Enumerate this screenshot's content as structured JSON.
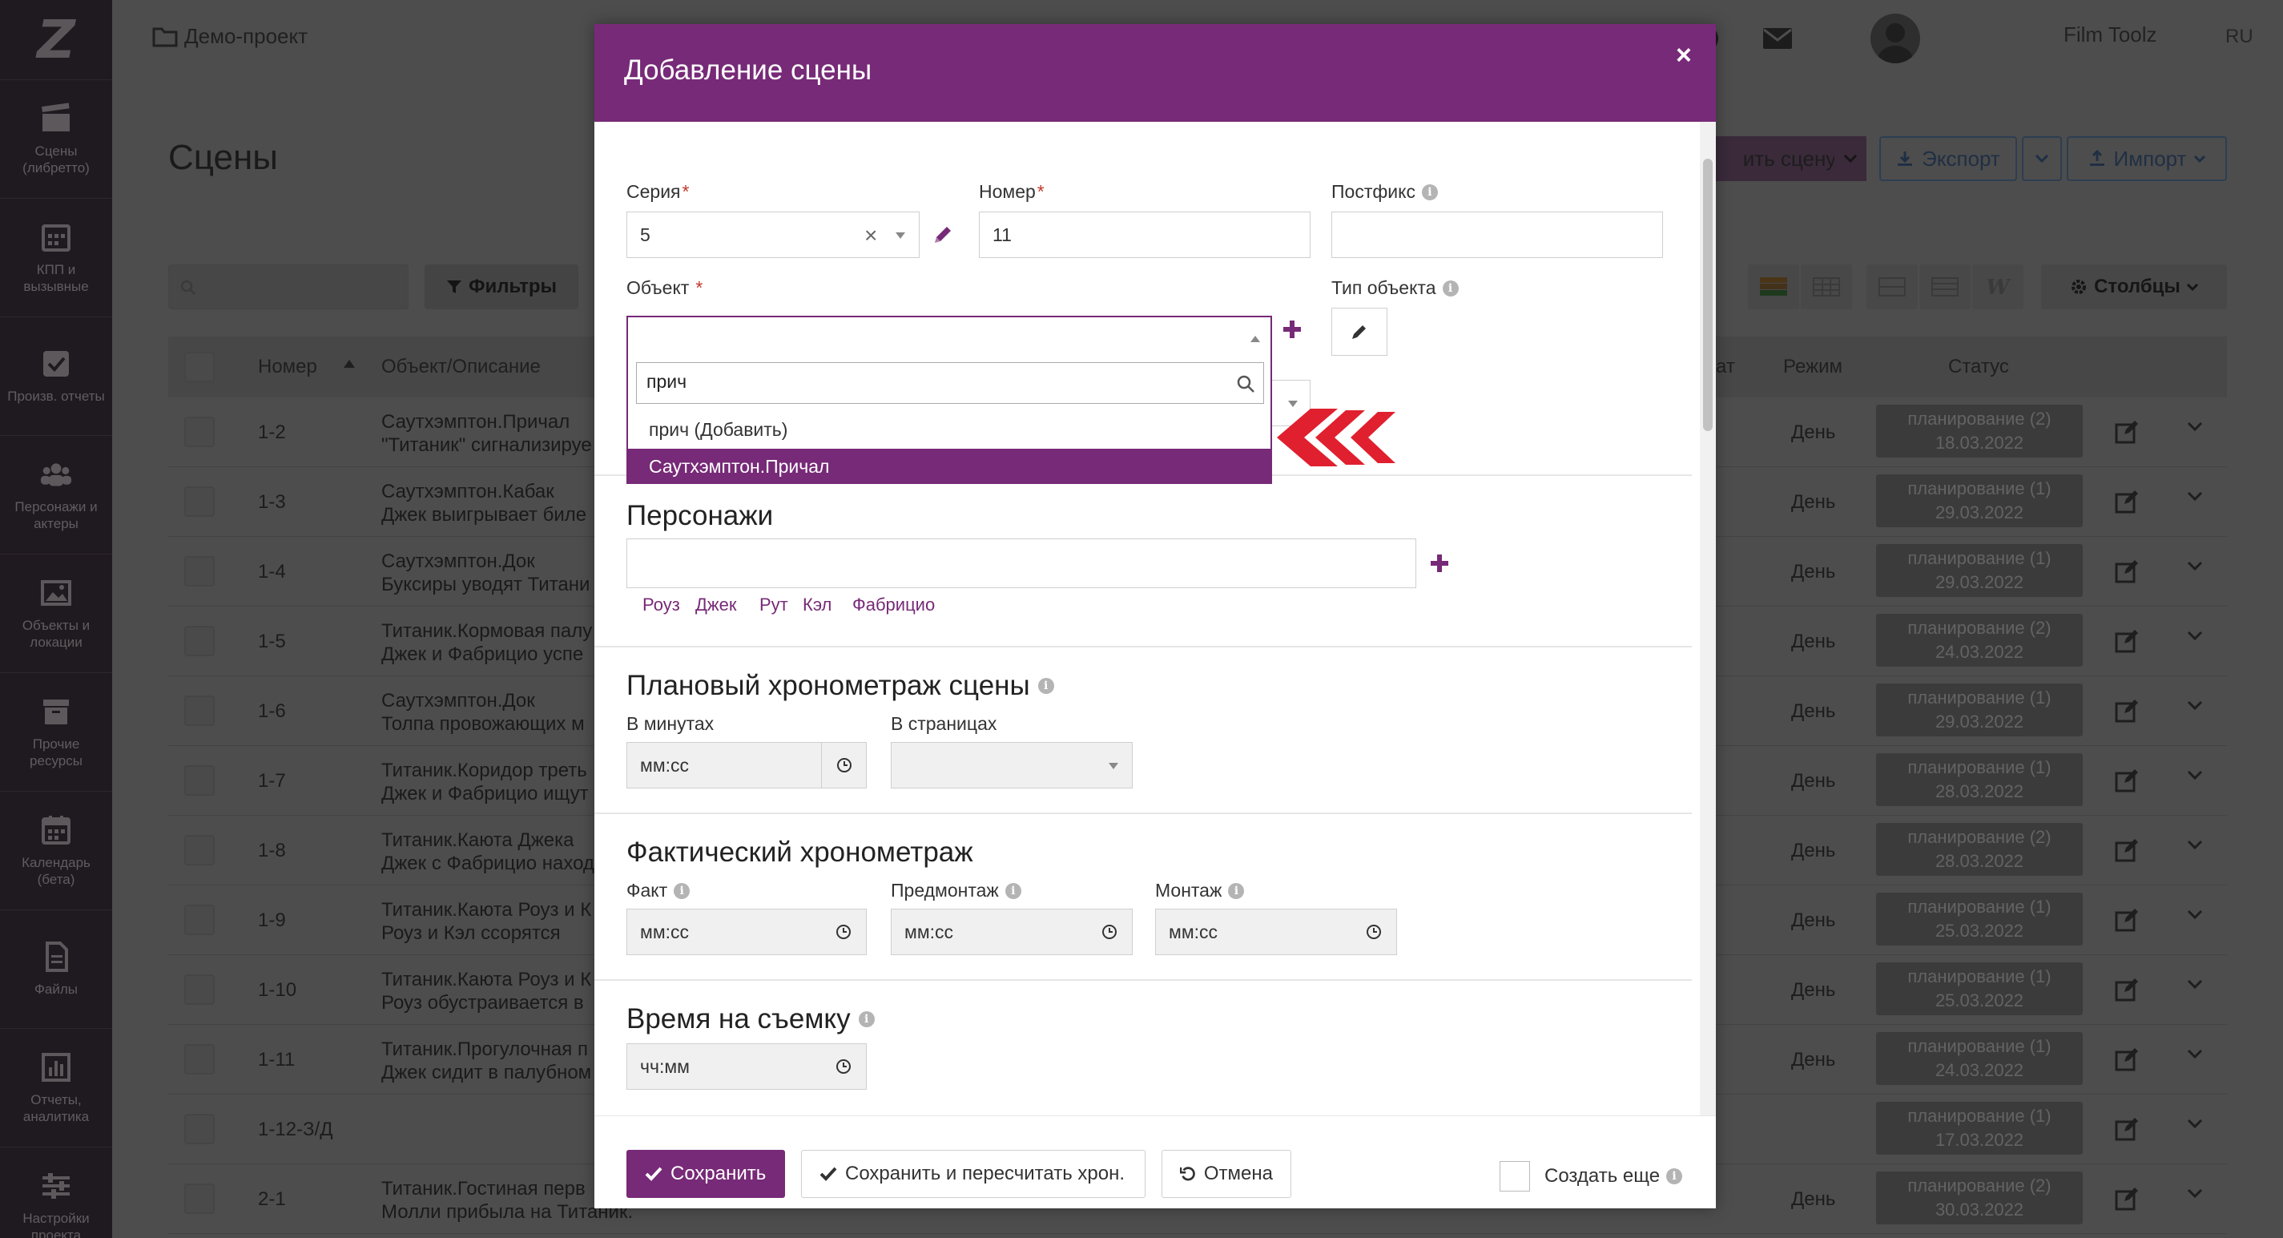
{
  "sidebar": {
    "logo": "Z",
    "items": [
      {
        "label": "Сцены\n(либретто)",
        "icon": "clapperboard-icon"
      },
      {
        "label": "КПП и\nвызывные",
        "icon": "calendar-grid-icon"
      },
      {
        "label": "Произв. отчеты",
        "icon": "checkbox-icon"
      },
      {
        "label": "Персонажи и\nактеры",
        "icon": "people-icon"
      },
      {
        "label": "Объекты и\nлокации",
        "icon": "image-icon"
      },
      {
        "label": "Прочие\nресурсы",
        "icon": "archive-icon"
      },
      {
        "label": "Календарь\n(бета)",
        "icon": "calendar-icon"
      },
      {
        "label": "Файлы",
        "icon": "file-icon"
      },
      {
        "label": "Отчеты,\nаналитика",
        "icon": "bar-chart-icon"
      },
      {
        "label": "Настройки\nпроекта",
        "icon": "sliders-icon"
      }
    ]
  },
  "header": {
    "breadcrumb": "Демо-проект",
    "username": "Film Toolz",
    "lang": "RU"
  },
  "page": {
    "title": "Сцены",
    "add_scene_partial": "ить сцену",
    "export_label": "Экспорт",
    "import_label": "Импорт",
    "filters_label": "Фильтры",
    "columns_label": "Столбцы",
    "table_headers": {
      "number": "Номер",
      "object": "Объект/Описание",
      "date_partial": "ат",
      "mode": "Режим",
      "status": "Статус"
    },
    "rows": [
      {
        "num": "1-2",
        "line1": "Саутхэмптон.Причал",
        "line2": "\"Титаник\" сигнализируе",
        "mode": "День",
        "status1": "планирование (2)",
        "status2": "18.03.2022"
      },
      {
        "num": "1-3",
        "line1": "Саутхэмптон.Кабак",
        "line2": "Джек выигрывает биле",
        "mode": "День",
        "status1": "планирование (1)",
        "status2": "29.03.2022"
      },
      {
        "num": "1-4",
        "line1": "Саутхэмптон.Док",
        "line2": "Буксиры уводят Титани",
        "mode": "День",
        "status1": "планирование (1)",
        "status2": "29.03.2022"
      },
      {
        "num": "1-5",
        "line1": "Титаник.Кормовая палу",
        "line2": "Джек и Фабрицио успе",
        "mode": "День",
        "status1": "планирование (2)",
        "status2": "24.03.2022"
      },
      {
        "num": "1-6",
        "line1": "Саутхэмптон.Док",
        "line2": "Толпа провожающих м",
        "mode": "День",
        "status1": "планирование (1)",
        "status2": "29.03.2022"
      },
      {
        "num": "1-7",
        "line1": "Титаник.Коридор треть",
        "line2": "Джек и Фабрицио ищут",
        "mode": "День",
        "status1": "планирование (1)",
        "status2": "28.03.2022"
      },
      {
        "num": "1-8",
        "line1": "Титаник.Каюта Джека",
        "line2": "Джек с Фабрицио наход",
        "mode": "День",
        "status1": "планирование (2)",
        "status2": "28.03.2022"
      },
      {
        "num": "1-9",
        "line1": "Титаник.Каюта Роуз и К",
        "line2": "Роуз и Кэл ссорятся",
        "mode": "День",
        "status1": "планирование (1)",
        "status2": "25.03.2022"
      },
      {
        "num": "1-10",
        "line1": "Титаник.Каюта Роуз и К",
        "line2": "Роуз обустраивается в",
        "mode": "День",
        "status1": "планирование (1)",
        "status2": "25.03.2022"
      },
      {
        "num": "1-11",
        "line1": "Титаник.Прогулочная п",
        "line2": "Джек сидит в палубном",
        "mode": "День",
        "status1": "планирование (1)",
        "status2": "24.03.2022"
      },
      {
        "num": "1-12-З/Д",
        "line1": "",
        "line2": "",
        "mode": "",
        "status1": "планирование (1)",
        "status2": "17.03.2022"
      },
      {
        "num": "2-1",
        "line1": "Титаник.Гостиная перв",
        "line2": "Молли прибыла на Титаник.",
        "mode": "День",
        "status1": "планирование (2)",
        "status2": "30.03.2022"
      }
    ]
  },
  "modal": {
    "title": "Добавление сцены",
    "close": "×",
    "series_label": "Серия",
    "series_value": "5",
    "number_label": "Номер",
    "number_value": "11",
    "postfix_label": "Постфикс",
    "object_label": "Объект",
    "object_type_label": "Тип объекта",
    "dropdown": {
      "search_value": "прич",
      "options": [
        "прич (Добавить)",
        "Саутхэмптон.Причал"
      ]
    },
    "characters_title": "Персонажи",
    "character_tags": [
      "Роуз",
      "Джек",
      "Рут",
      "Кэл",
      "Фабрицио"
    ],
    "planned_title": "Плановый хронометраж сцены",
    "in_minutes_label": "В минутах",
    "in_pages_label": "В страницах",
    "mmss_placeholder": "мм:сс",
    "actual_title": "Фактический хронометраж",
    "fact_label": "Факт",
    "premontage_label": "Предмонтаж",
    "montage_label": "Монтаж",
    "shoot_time_title": "Время на съемку",
    "hhmm_placeholder": "чч:мм",
    "required_mark": "*",
    "info_mark": "i"
  },
  "footer": {
    "save": "Сохранить",
    "save_recalc": "Сохранить и пересчитать хрон.",
    "cancel": "Отмена",
    "create_more": "Создать еще"
  },
  "colors": {
    "brand": "#772a77",
    "annotation_arrow": "#e0202e"
  }
}
